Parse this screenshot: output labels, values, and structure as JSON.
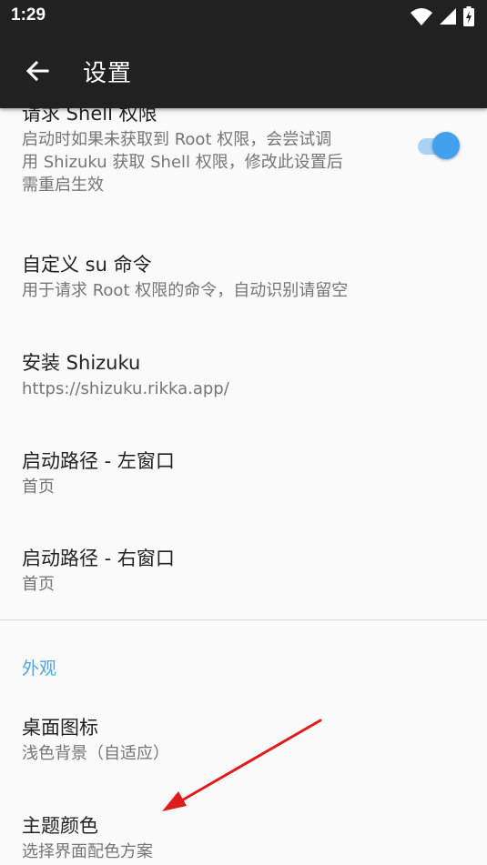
{
  "status_bar": {
    "time": "1:29",
    "icons": [
      "wifi-icon",
      "signal-icon",
      "battery-charging-icon"
    ]
  },
  "app_bar": {
    "title": "设置",
    "back_icon": "arrow-left-icon"
  },
  "preferences": [
    {
      "key": "request-shell-permission",
      "title": "请求 Shell 权限",
      "summary_lines": [
        "启动时如果未获取到 Root 权限，会尝试调",
        "用 Shizuku 获取 Shell 权限，修改此设置后",
        "需重启生效"
      ],
      "switch_on": true
    },
    {
      "key": "custom-su-command",
      "title": "自定义 su 命令",
      "summary": "用于请求 Root 权限的命令，自动识别请留空"
    },
    {
      "key": "install-shizuku",
      "title": "安装 Shizuku",
      "summary": "https://shizuku.rikka.app/"
    },
    {
      "key": "start-path-left",
      "title": "启动路径 - 左窗口",
      "summary": "首页"
    },
    {
      "key": "start-path-right",
      "title": "启动路径 - 右窗口",
      "summary": "首页"
    }
  ],
  "appearance": {
    "category_title": "外观",
    "items": [
      {
        "key": "desktop-icon",
        "title": "桌面图标",
        "summary": "浅色背景（自适应）"
      },
      {
        "key": "theme-color",
        "title": "主题颜色",
        "summary": "选择界面配色方案"
      }
    ]
  },
  "colors": {
    "app_bar": "#212121",
    "accent": "#42a0ee",
    "category_text": "#4fa5dc",
    "annotation_arrow": "#e01b1b"
  }
}
